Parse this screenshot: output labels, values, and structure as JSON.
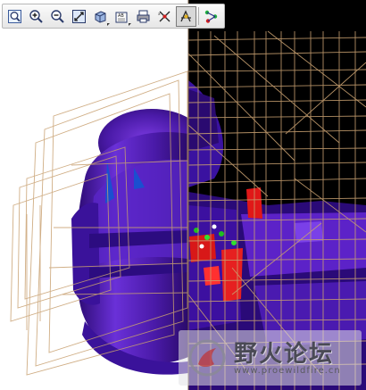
{
  "toolbar": {
    "buttons": [
      {
        "icon": "zoom-fit-icon"
      },
      {
        "icon": "zoom-in-icon"
      },
      {
        "icon": "zoom-out-icon"
      },
      {
        "icon": "refit-icon"
      },
      {
        "icon": "shading-icon",
        "flyout": true
      },
      {
        "icon": "saved-views-icon",
        "flyout": true
      },
      {
        "icon": "print-icon"
      },
      {
        "icon": "datum-display-icon"
      },
      {
        "icon": "spin-center-icon",
        "active": true
      },
      {
        "icon": "mechanism-icon"
      }
    ]
  },
  "viewport": {
    "background_left": "#ffffff",
    "background_right": "#000000",
    "model_color": "#5a1fc0",
    "wireframe_color": "#c8a070",
    "highlight_color": "#ff2020"
  },
  "watermark": {
    "title": "野火论坛",
    "url": "www.proewildfire.cn"
  }
}
